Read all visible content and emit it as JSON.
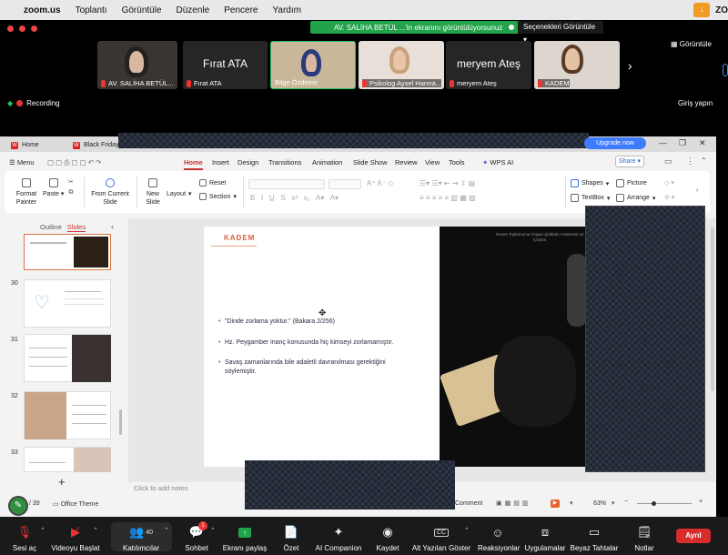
{
  "menubar": {
    "app": "zoom.us",
    "items": [
      "Toplantı",
      "Görüntüle",
      "Düzenle",
      "Pencere",
      "Yardım"
    ],
    "right_label": "ZO"
  },
  "share_banner": {
    "text": "AV. SALİHA BETÜL ...'in ekranını görüntülüyorsunuz",
    "options": "Seçenekleri Görüntüle"
  },
  "participants": [
    {
      "name": "AV. SALİHA BETÜL..."
    },
    {
      "name": "Fırat ATA",
      "big": "Fırat ATA"
    },
    {
      "name": "Bilge Özdemir"
    },
    {
      "name": "Psikolog Aysel Harma..."
    },
    {
      "name": "meryem Ateş",
      "big": "meryem Ateş"
    },
    {
      "name": "KADEM"
    }
  ],
  "view_label": "Görüntüle",
  "recording": "Recording",
  "login": "Giriş yapın",
  "wps": {
    "tabs": [
      "Home",
      "Black Friday Sale"
    ],
    "upgrade": "Upgrade now",
    "menu": [
      "Menu",
      "Home",
      "Insert",
      "Design",
      "Transitions",
      "Animation",
      "Slide Show",
      "Review",
      "View",
      "Tools",
      "WPS AI"
    ],
    "share": "Share",
    "ribbon": {
      "format_painter": "Format Painter",
      "paste": "Paste",
      "from_current": "From Current Slide",
      "new_slide": "New Slide",
      "layout": "Layout",
      "reset": "Reset",
      "section": "Section",
      "shapes": "Shapes",
      "picture": "Picture",
      "textbox": "TextBox",
      "arrange": "Arrange"
    },
    "panel_tabs": [
      "Outline",
      "Slides"
    ],
    "slide_numbers": [
      "30",
      "31",
      "32",
      "33"
    ],
    "slide": {
      "brand": "KADEM",
      "caption": "Güven Toplumunun İnşası Şiddetin Anatomisi ve Çözüm",
      "bullets": [
        "\"Dinde zorlama yoktur.\" (Bakara 2/256)",
        "Hz. Peygamber inanç konusunda hiç kimseyi zorlamamıştır.",
        "Savaş zamanlarında bile adaletli davranılması gerektiğini söylemiştir."
      ]
    },
    "notes_placeholder": "Click to add notes",
    "status": {
      "slide_count": "/ 39",
      "theme": "Office Theme",
      "comment": "Comment",
      "zoom": "63%"
    }
  },
  "zoombar": {
    "items": [
      "Sesi aç",
      "Videoyu Başlat",
      "Katılımcılar",
      "Sohbet",
      "Ekranı paylaş",
      "Özet",
      "AI Companion",
      "Kaydet",
      "Alt Yazıları Göster",
      "Reaksiyonlar",
      "Uygulamalar",
      "Beyaz Tahtalar",
      "Notlar"
    ],
    "participant_count": "40",
    "chat_badge": "1",
    "leave": "Ayrıl"
  },
  "colors": {
    "zoom_green": "#22a34a",
    "wps_accent": "#cc3333",
    "leave_red": "#d82b2b",
    "brand_orange": "#d9603a"
  }
}
